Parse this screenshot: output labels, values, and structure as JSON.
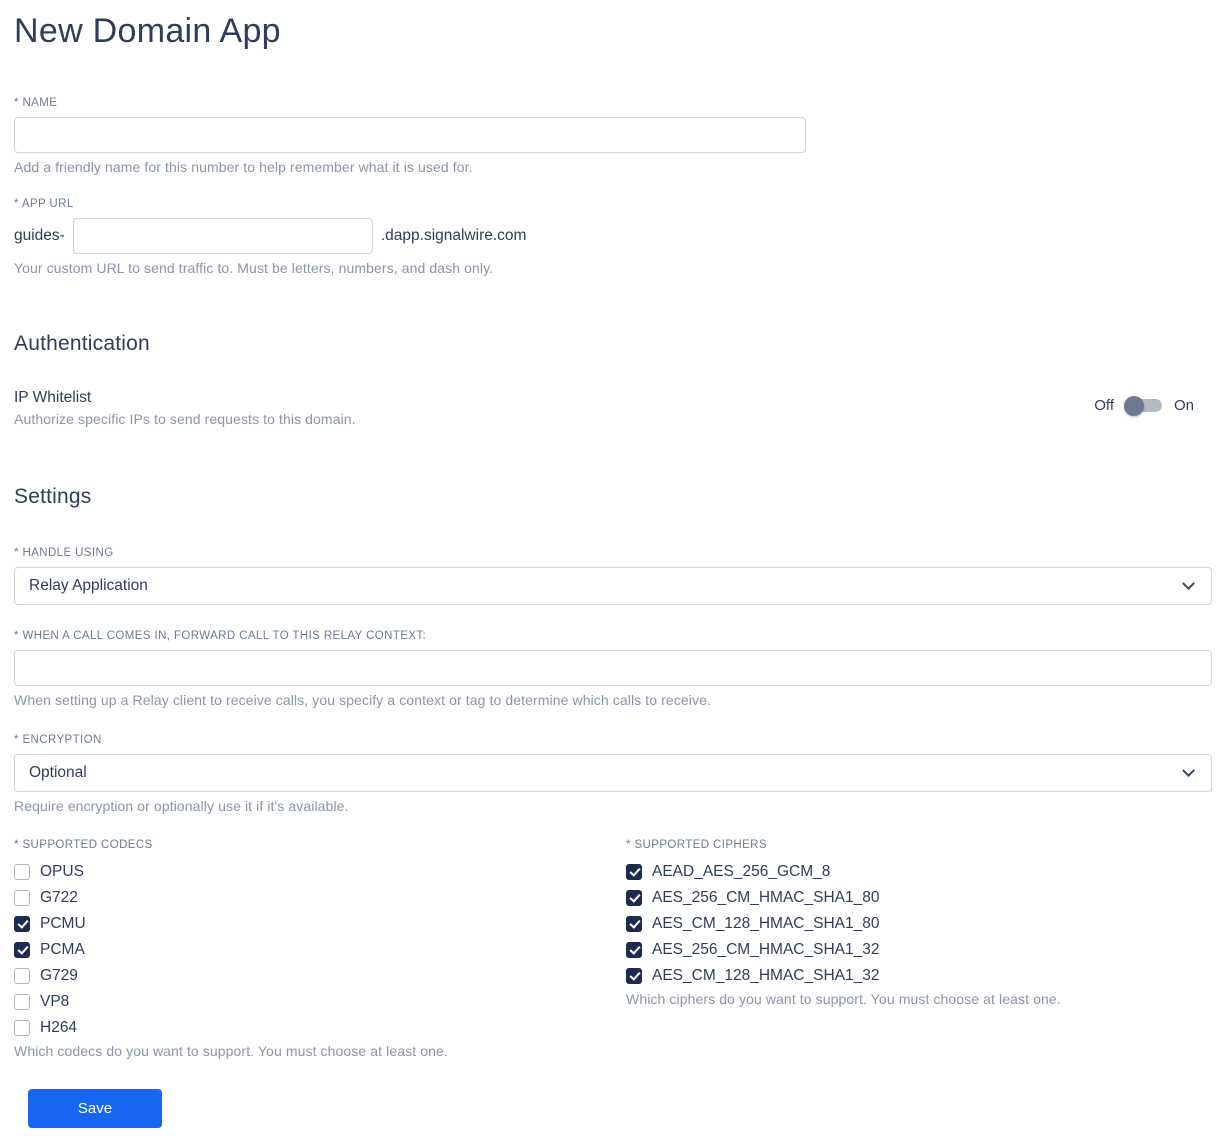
{
  "page": {
    "title": "New Domain App"
  },
  "name_field": {
    "label": "* NAME",
    "value": "",
    "help": "Add a friendly name for this number to help remember what it is used for."
  },
  "app_url_field": {
    "label": "* APP URL",
    "prefix": "guides-",
    "value": "",
    "suffix": ".dapp.signalwire.com",
    "help": "Your custom URL to send traffic to. Must be letters, numbers, and dash only."
  },
  "authentication": {
    "heading": "Authentication",
    "ip_whitelist": {
      "label": "IP Whitelist",
      "help": "Authorize specific IPs to send requests to this domain.",
      "off_label": "Off",
      "on_label": "On",
      "state": "off"
    }
  },
  "settings": {
    "heading": "Settings",
    "handle_using": {
      "label": "* HANDLE USING",
      "value": "Relay Application"
    },
    "relay_context": {
      "label": "* WHEN A CALL COMES IN, FORWARD CALL TO THIS RELAY CONTEXT:",
      "value": "",
      "help": "When setting up a Relay client to receive calls, you specify a context or tag to determine which calls to receive."
    },
    "encryption": {
      "label": "* ENCRYPTION",
      "value": "Optional",
      "help": "Require encryption or optionally use it if it's available."
    },
    "codecs": {
      "label": "* SUPPORTED CODECS",
      "options": [
        {
          "label": "OPUS",
          "checked": false
        },
        {
          "label": "G722",
          "checked": false
        },
        {
          "label": "PCMU",
          "checked": true
        },
        {
          "label": "PCMA",
          "checked": true
        },
        {
          "label": "G729",
          "checked": false
        },
        {
          "label": "VP8",
          "checked": false
        },
        {
          "label": "H264",
          "checked": false
        }
      ],
      "help": "Which codecs do you want to support. You must choose at least one."
    },
    "ciphers": {
      "label": "* SUPPORTED CIPHERS",
      "options": [
        {
          "label": "AEAD_AES_256_GCM_8",
          "checked": true
        },
        {
          "label": "AES_256_CM_HMAC_SHA1_80",
          "checked": true
        },
        {
          "label": "AES_CM_128_HMAC_SHA1_80",
          "checked": true
        },
        {
          "label": "AES_256_CM_HMAC_SHA1_32",
          "checked": true
        },
        {
          "label": "AES_CM_128_HMAC_SHA1_32",
          "checked": true
        }
      ],
      "help": "Which ciphers do you want to support. You must choose at least one."
    }
  },
  "actions": {
    "save_label": "Save"
  },
  "colors": {
    "accent_blue": "#1566f0",
    "checkbox_checked": "#1d2b50",
    "text_dark": "#2f3d59",
    "text_muted": "#8b94a8"
  }
}
